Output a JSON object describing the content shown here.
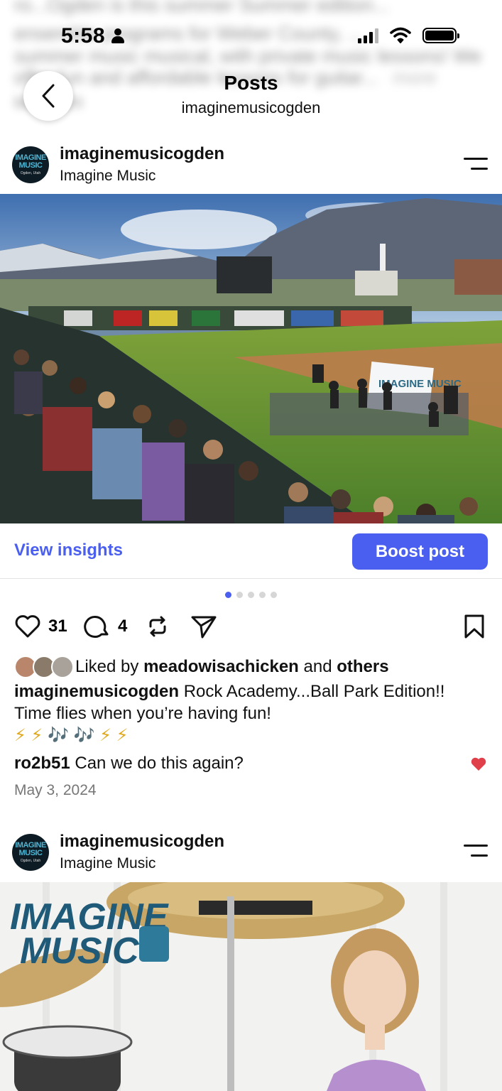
{
  "status_bar": {
    "time": "5:58"
  },
  "background_text": {
    "line1": "ro...Ogden is this summer Summer edition...",
    "line2": "ensemble programs for Weber County, ...",
    "line3": "summer music musical, with private music lessons! We",
    "line4": "offer fun and affordable lessons for guitar...",
    "line4_more": "more",
    "line5": "May 2024"
  },
  "header": {
    "title": "Posts",
    "subtitle": "imaginemusicogden"
  },
  "avatar_logo": {
    "line1": "IMAGINE",
    "line2": "MUSIC",
    "city": "Ogden, Utah"
  },
  "posts": [
    {
      "username": "imaginemusicogden",
      "audio": "Imagine Music",
      "view_insights": "View insights",
      "boost_post": "Boost post",
      "carousel": {
        "count": 5,
        "active": 1
      },
      "likes": "31",
      "comments": "4",
      "liked_by_prefix": "Liked by",
      "liked_by_user": "meadowisachicken",
      "liked_by_and": "and",
      "liked_by_others": "others",
      "caption_user": "imaginemusicogden",
      "caption_text": "Rock Academy...Ball Park Edition!! Time flies when you’re having fun!",
      "caption_emojis": "⚡ ⚡ 🎶 🎶 ⚡ ⚡",
      "comment_user": "ro2b51",
      "comment_text": "Can we do this again?",
      "date": "May 3, 2024",
      "image_banner": "IMAGINE MUSIC"
    },
    {
      "username": "imaginemusicogden",
      "audio": "Imagine Music",
      "image_logo_line1": "IMAGINE",
      "image_logo_line2": "MUSIC"
    }
  ],
  "colors": {
    "accent": "#4a5ff0",
    "heart": "#e0404a",
    "muted_text": "#777777"
  }
}
